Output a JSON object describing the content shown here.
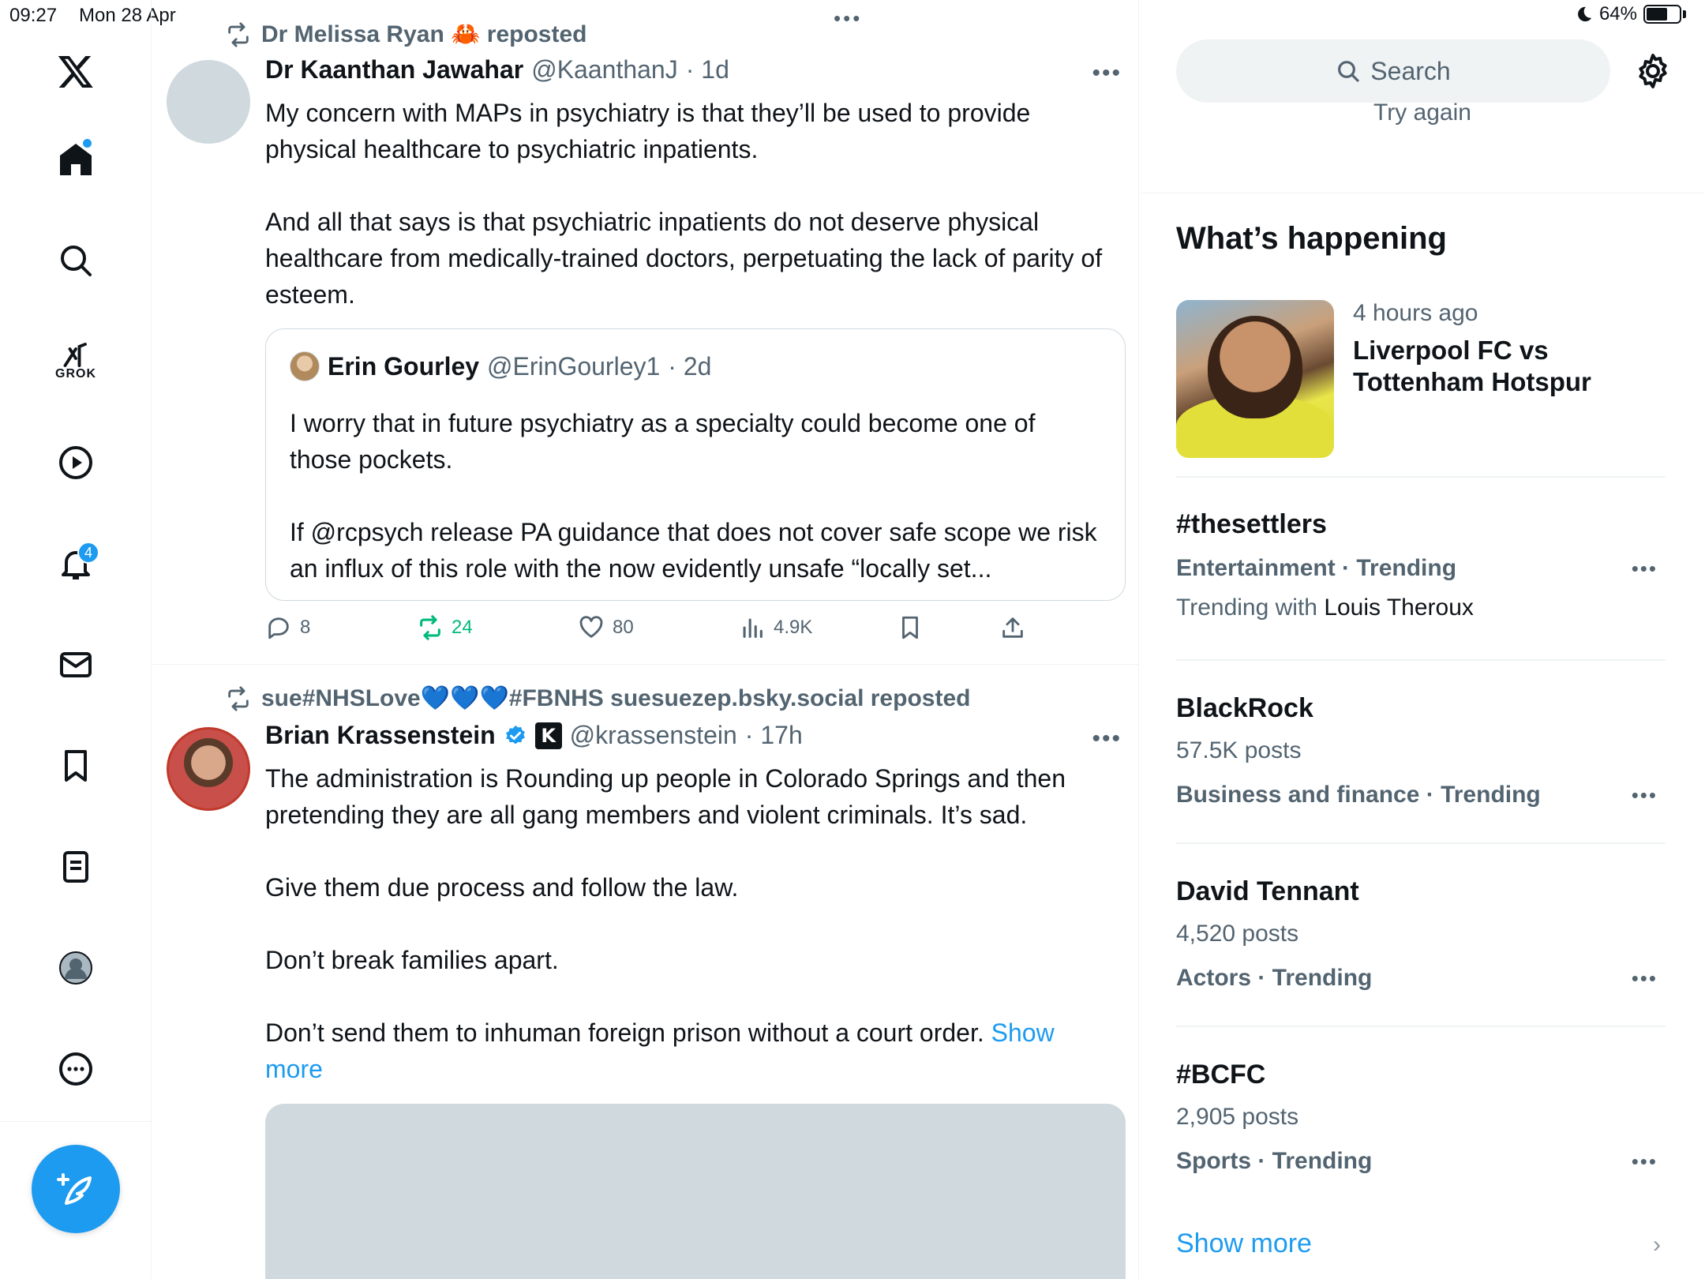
{
  "status_bar": {
    "time": "09:27",
    "date": "Mon 28 Apr",
    "battery": "64%",
    "battery_level": 0.64
  },
  "nav": {
    "grok_label": "GROK",
    "notifications_badge": "4"
  },
  "feed": {
    "tweet1": {
      "repost_by": "Dr Melissa Ryan 🦀 reposted",
      "name": "Dr Kaanthan Jawahar",
      "handle": "@KaanthanJ",
      "time": "· 1d",
      "text": "My concern with MAPs in psychiatry is that they’ll be used to provide physical healthcare to psychiatric inpatients.\n\nAnd all that says is that psychiatric inpatients do not deserve physical healthcare from medically-trained doctors, perpetuating the lack of parity of esteem.",
      "quote": {
        "name": "Erin Gourley",
        "handle": "@ErinGourley1",
        "time": "· 2d",
        "text": "I worry that in future psychiatry as a specialty could become one of those pockets.\n\nIf @rcpsych release PA guidance that does not cover safe scope we risk an influx of this role with the now evidently unsafe “locally set..."
      },
      "actions": {
        "replies": "8",
        "reposts": "24",
        "likes": "80",
        "views": "4.9K"
      }
    },
    "tweet2": {
      "repost_by": "sue#NHSLove💙💙💙#FBNHS suesuezep.bsky.social reposted",
      "name": "Brian Krassenstein",
      "affiliate": "K",
      "handle": "@krassenstein",
      "time": "· 17h",
      "text": "The administration is Rounding up people in Colorado Springs and then pretending they are all gang members and violent criminals. It’s sad.\n\nGive them due process and follow the law.\n\nDon’t break families apart.\n\nDon’t send them to inhuman foreign prison without a court order. ",
      "show_more": "Show more"
    }
  },
  "sidebar": {
    "search_placeholder": "Search",
    "try_again": "Try again",
    "whats_happening": "What’s happening",
    "event": {
      "time": "4 hours ago",
      "title": "Liverpool FC vs Tottenham Hotspur"
    },
    "trends": [
      {
        "title": "#thesettlers",
        "category": "Entertainment · Trending",
        "extra_prefix": "Trending with ",
        "extra_name": "Louis Theroux"
      },
      {
        "title": "BlackRock",
        "posts": "57.5K posts",
        "category": "Business and finance · Trending"
      },
      {
        "title": "David Tennant",
        "posts": "4,520 posts",
        "category": "Actors · Trending"
      },
      {
        "title": "#BCFC",
        "posts": "2,905 posts",
        "category": "Sports · Trending"
      }
    ],
    "show_more": "Show more"
  },
  "colors": {
    "accent": "#1d9bf0",
    "repost_green": "#00ba7c",
    "secondary_text": "#536471"
  }
}
